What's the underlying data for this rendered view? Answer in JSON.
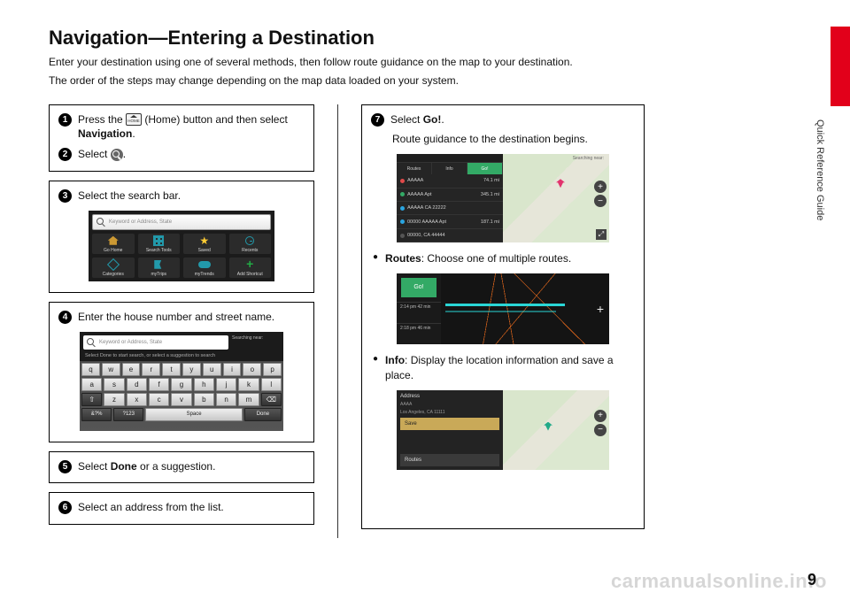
{
  "page_number": "9",
  "side_label": "Quick Reference Guide",
  "watermark": "carmanualsonline.info",
  "title": "Navigation—Entering a Destination",
  "intro": {
    "line1": "Enter your destination using one of several methods, then follow route guidance on the map to your destination.",
    "line2": "The order of the steps may change depending on the map data loaded on your system."
  },
  "icons": {
    "home_label": "(Home)"
  },
  "steps": {
    "s1": {
      "num": "1",
      "pre": "Press the ",
      "post": " button and then select ",
      "bold": "Navigation",
      "end": "."
    },
    "s2": {
      "num": "2",
      "pre": "Select ",
      "end": "."
    },
    "s3": {
      "num": "3",
      "text": "Select the search bar."
    },
    "s4": {
      "num": "4",
      "text": "Enter the house number and street name."
    },
    "s5": {
      "num": "5",
      "pre": "Select ",
      "bold": "Done",
      "post": " or a suggestion."
    },
    "s6": {
      "num": "6",
      "text": "Select an address from the list."
    },
    "s7": {
      "num": "7",
      "pre": "Select ",
      "bold": "Go!",
      "end": ".",
      "note": "Route guidance to the destination begins."
    }
  },
  "bullets": {
    "routes": {
      "bold": "Routes",
      "text": ": Choose one of multiple routes."
    },
    "info": {
      "bold": "Info",
      "text": ": Display the location information and save a place."
    }
  },
  "screen3": {
    "placeholder": "Keyword or Address, State",
    "tiles": [
      "Go Home",
      "Search Tools",
      "Saved",
      "Recents",
      "Categories",
      "myTrips",
      "myTrends",
      "Add Shortcut"
    ]
  },
  "screen4": {
    "placeholder": "Keyword or Address, State",
    "near": "Searching near:",
    "hint": "Select Done to start search, or select a suggestion to search",
    "row1": [
      "q",
      "w",
      "e",
      "r",
      "t",
      "y",
      "u",
      "i",
      "o",
      "p"
    ],
    "row2": [
      "a",
      "s",
      "d",
      "f",
      "g",
      "h",
      "j",
      "k",
      "l"
    ],
    "row3": [
      "⇧",
      "z",
      "x",
      "c",
      "v",
      "b",
      "n",
      "m",
      "⌫"
    ],
    "row4": {
      "sym": "&?%",
      "alt": "?123",
      "space": "Space",
      "done": "Done"
    }
  },
  "screen7a": {
    "near": "Searching near:",
    "tabs": [
      "Routes",
      "Info",
      "Go!"
    ],
    "items": [
      {
        "color": "#e04a4a",
        "t": "AAAAA",
        "d": "74.1 mi"
      },
      {
        "color": "#3a6",
        "t": "AAAAA Apt",
        "d": "345.1 mi"
      },
      {
        "color": "#2aa5e0",
        "t": "AAAAA CA 22222",
        "d": ""
      },
      {
        "color": "#2aa5e0",
        "t": "00000 AAAAA Apt",
        "d": "187.1 mi"
      },
      {
        "color": "#444",
        "t": "00000, CA 44444",
        "d": ""
      }
    ]
  },
  "screen7b": {
    "go": "Go!",
    "opt1": "2:14 pm\n42 min",
    "opt2": "2:18 pm\n46 min"
  },
  "screen7c": {
    "hdr": "Address",
    "addr1": "AAAA",
    "addr2": "Los Angeles, CA 11111",
    "save": "Save",
    "routes": "Routes"
  }
}
